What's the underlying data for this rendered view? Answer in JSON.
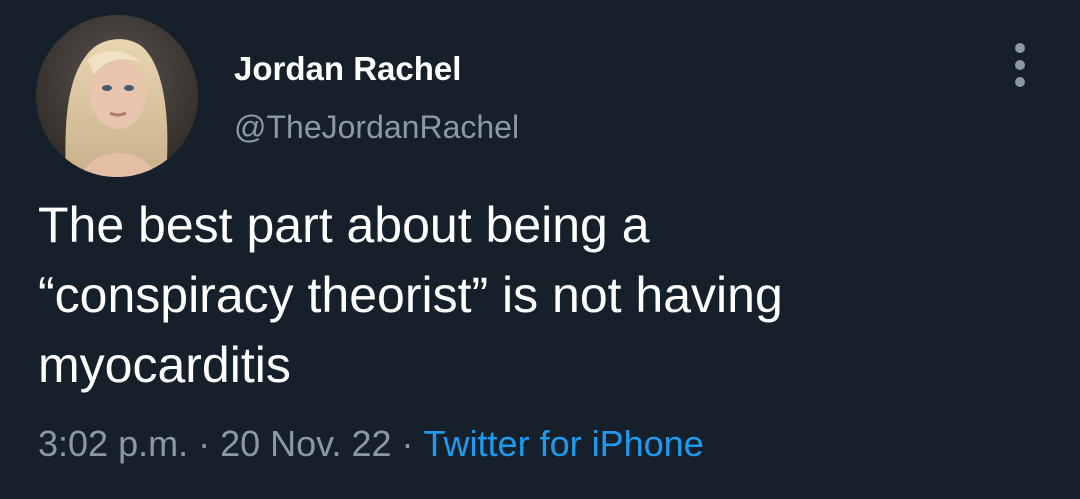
{
  "author": {
    "display_name": "Jordan Rachel",
    "handle": "@TheJordanRachel",
    "avatar_icon": "profile-photo"
  },
  "tweet": {
    "text": "The best part about being a\n“conspiracy theorist” is not having\nmyocarditis",
    "time": "3:02 p.m.",
    "separator": "·",
    "date": "20 Nov. 22",
    "source": "Twitter for iPhone"
  },
  "actions": {
    "more_icon": "more-vertical-icon"
  },
  "colors": {
    "background": "#15202b",
    "primary_text": "#ffffff",
    "secondary_text": "#8b98a5",
    "link": "#1d9bf0"
  }
}
